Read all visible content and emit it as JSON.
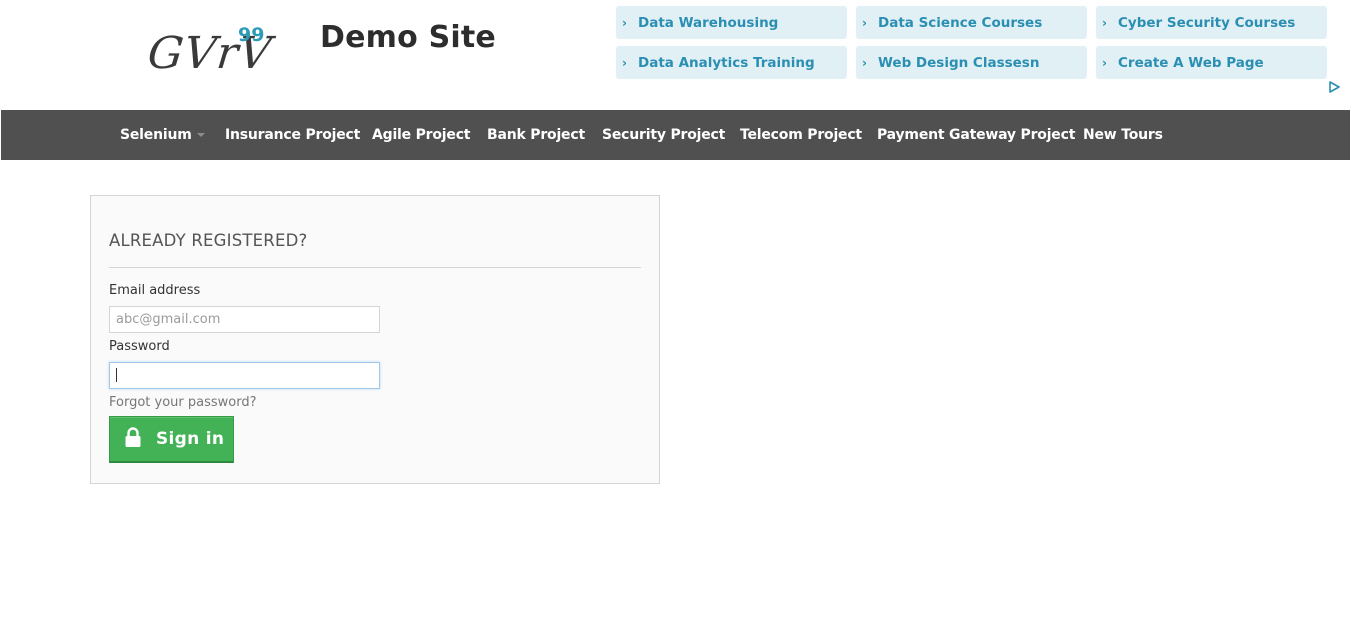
{
  "brand": {
    "logo_word": "GVrV",
    "logo_number": "99",
    "site_title": "Demo Site"
  },
  "ads": [
    {
      "label": "Data Warehousing",
      "icon": "chevron-right-icon"
    },
    {
      "label": "Data Science Courses",
      "icon": "chevron-right-icon"
    },
    {
      "label": "Cyber Security Courses",
      "icon": "chevron-right-icon"
    },
    {
      "label": "Data Analytics Training",
      "icon": "chevron-right-icon"
    },
    {
      "label": "Web Design Classesn",
      "icon": "chevron-right-icon"
    },
    {
      "label": "Create A Web Page",
      "icon": "chevron-right-icon"
    }
  ],
  "ad_marker_icon": "adchoices-icon",
  "nav": {
    "items": [
      {
        "label": "Selenium",
        "has_dropdown": true
      },
      {
        "label": "Insurance Project"
      },
      {
        "label": "Agile Project"
      },
      {
        "label": "Bank Project"
      },
      {
        "label": "Security Project"
      },
      {
        "label": "Telecom Project"
      },
      {
        "label": "Payment Gateway Project"
      },
      {
        "label": "New Tours"
      }
    ]
  },
  "login": {
    "heading": "ALREADY REGISTERED?",
    "email_label": "Email address",
    "email_placeholder": "abc@gmail.com",
    "email_value": "",
    "password_label": "Password",
    "password_value": "",
    "forgot_link": "Forgot your password?",
    "signin_label": "Sign in",
    "signin_icon": "lock-icon"
  },
  "colors": {
    "nav_bg": "#505050",
    "ad_bg": "#e1f0f5",
    "ad_text": "#2a8fb2",
    "signin_bg": "#43b155",
    "logo_accent": "#2e9bb6"
  }
}
